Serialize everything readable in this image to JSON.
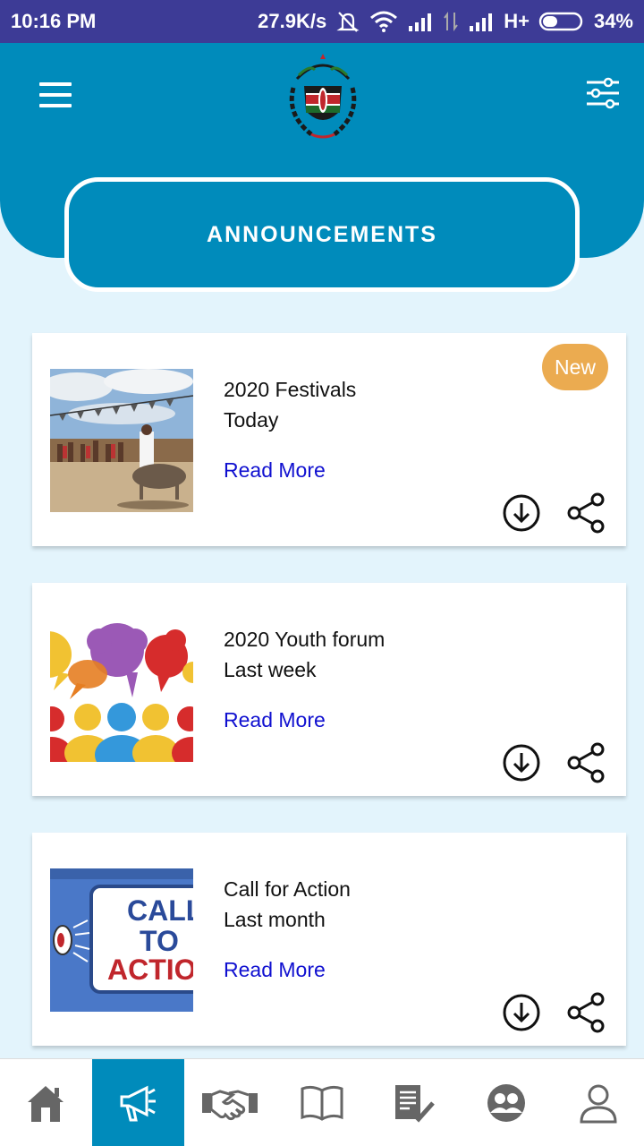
{
  "status_bar": {
    "time": "10:16 PM",
    "speed": "27.9K/s",
    "network": "H+",
    "battery": "34%"
  },
  "header": {
    "title": "ANNOUNCEMENTS"
  },
  "announcements": [
    {
      "title": "2020 Festivals",
      "date": "Today",
      "link": "Read More",
      "badge": "New",
      "thumb": "festival-photo"
    },
    {
      "title": "2020 Youth forum",
      "date": "Last week",
      "link": "Read More",
      "badge": "",
      "thumb": "youth-forum-illustration"
    },
    {
      "title": "Call for Action",
      "date": "Last month",
      "link": "Read More",
      "badge": "",
      "thumb": "call-to-action-illustration"
    }
  ],
  "thumb_text": {
    "line1": "CALL",
    "line2": "TO",
    "line3": "ACTION"
  },
  "bottom_nav": [
    {
      "icon": "home-icon",
      "active": false
    },
    {
      "icon": "megaphone-icon",
      "active": true
    },
    {
      "icon": "handshake-icon",
      "active": false
    },
    {
      "icon": "book-icon",
      "active": false
    },
    {
      "icon": "checklist-icon",
      "active": false
    },
    {
      "icon": "community-icon",
      "active": false
    },
    {
      "icon": "profile-icon",
      "active": false
    }
  ],
  "colors": {
    "status_bar": "#3d3b96",
    "primary": "#008bbb",
    "background": "#e3f4fc",
    "badge": "#ebab50",
    "link": "#1010d0",
    "nav_icon": "#666666"
  }
}
